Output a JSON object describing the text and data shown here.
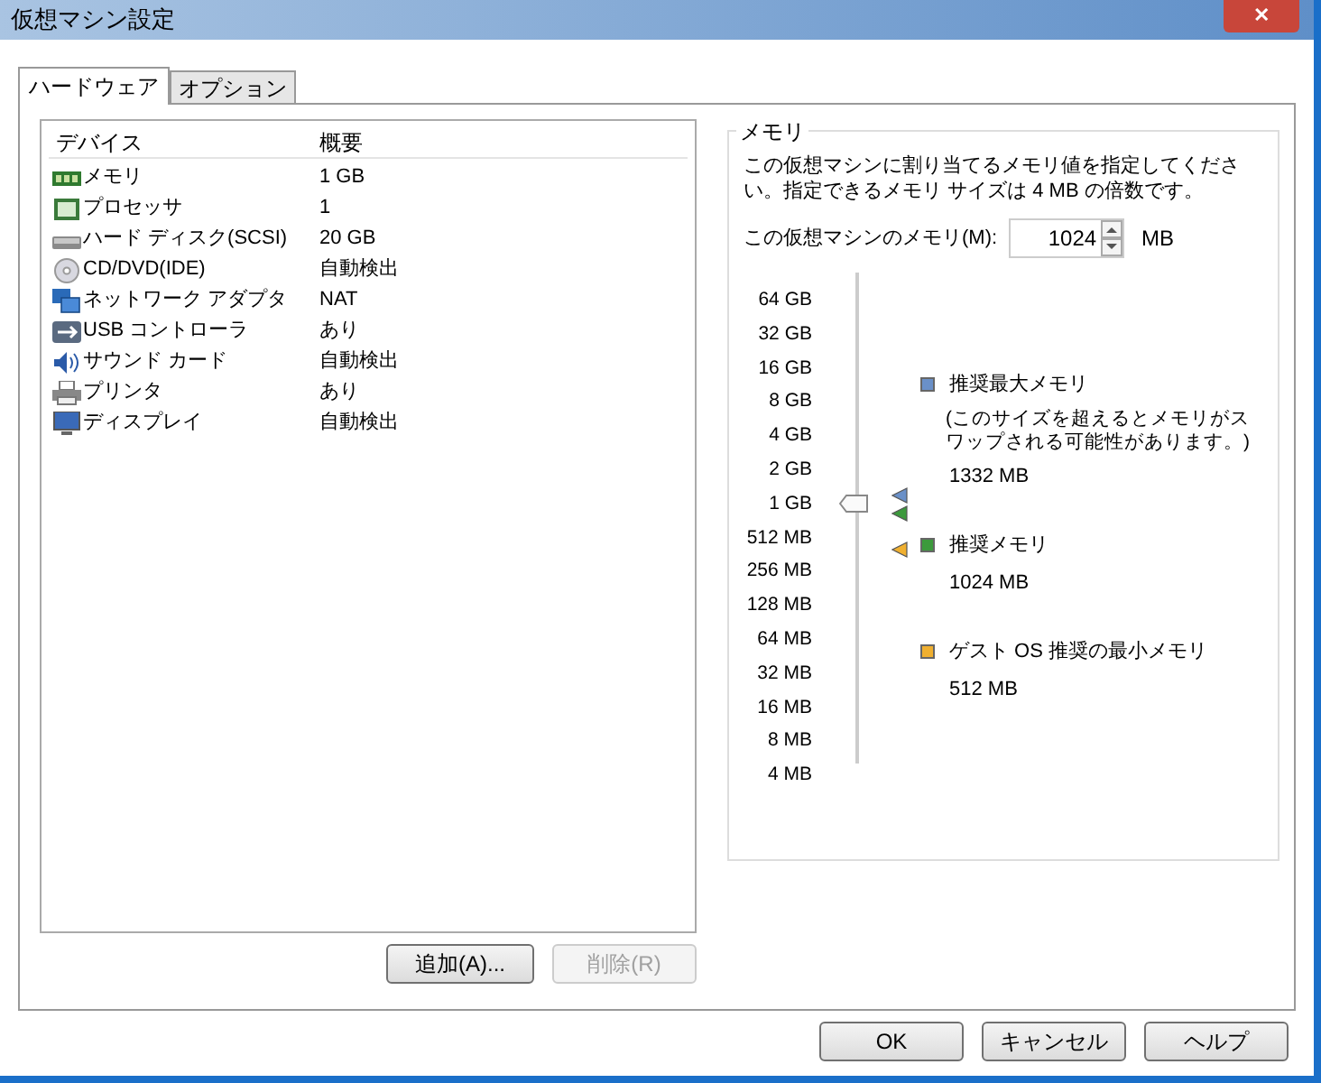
{
  "window": {
    "title": "仮想マシン設定",
    "close": "✕"
  },
  "tabs": [
    {
      "label": "ハードウェア",
      "selected": true
    },
    {
      "label": "オプション",
      "selected": false
    }
  ],
  "devices": {
    "columns": [
      "デバイス",
      "概要"
    ],
    "rows": [
      {
        "kind": "memory",
        "name": "メモリ",
        "summary": "1 GB",
        "selected": false
      },
      {
        "kind": "processor",
        "name": "プロセッサ",
        "summary": "1",
        "selected": false
      },
      {
        "kind": "disk",
        "name": "ハード ディスク(SCSI)",
        "summary": "20 GB",
        "selected": false
      },
      {
        "kind": "cd",
        "name": "CD/DVD(IDE)",
        "summary": "自動検出",
        "selected": false
      },
      {
        "kind": "network",
        "name": "ネットワーク アダプタ",
        "summary": "NAT",
        "selected": false
      },
      {
        "kind": "usb",
        "name": "USB コントローラ",
        "summary": "あり",
        "selected": false
      },
      {
        "kind": "sound",
        "name": "サウンド カード",
        "summary": "自動検出",
        "selected": false
      },
      {
        "kind": "printer",
        "name": "プリンタ",
        "summary": "あり",
        "selected": false
      },
      {
        "kind": "display",
        "name": "ディスプレイ",
        "summary": "自動検出",
        "selected": false
      }
    ],
    "buttons": [
      {
        "label": "追加(A)...",
        "disabled": false
      },
      {
        "label": "削除(R)",
        "disabled": true
      }
    ]
  },
  "memory": {
    "title": "メモリ",
    "description": "この仮想マシンに割り当てるメモリ値を指定してください。指定できるメモリ サイズは 4 MB の倍数です。",
    "field_label": "この仮想マシンのメモリ(M):",
    "value": "1024",
    "unit": "MB",
    "scale": [
      "64 GB",
      "32 GB",
      "16 GB",
      "8 GB",
      "4 GB",
      "2 GB",
      "1 GB",
      "512 MB",
      "256 MB",
      "128 MB",
      "64 MB",
      "32 MB",
      "16 MB",
      "8 MB",
      "4 MB"
    ],
    "level": 0.571,
    "legend": [
      {
        "label": "推奨最大メモリ",
        "note": "(このサイズを超えるとメモリがスワップされる可能性があります。)",
        "value": "1332 MB",
        "color": "#6a90c8"
      },
      {
        "label": "推奨メモリ",
        "value": "1024 MB",
        "color": "#3c9a3c"
      },
      {
        "label": "ゲスト OS 推奨の最小メモリ",
        "value": "512 MB",
        "color": "#f0b030"
      }
    ]
  },
  "buttons": [
    "OK",
    "キャンセル",
    "ヘルプ"
  ]
}
